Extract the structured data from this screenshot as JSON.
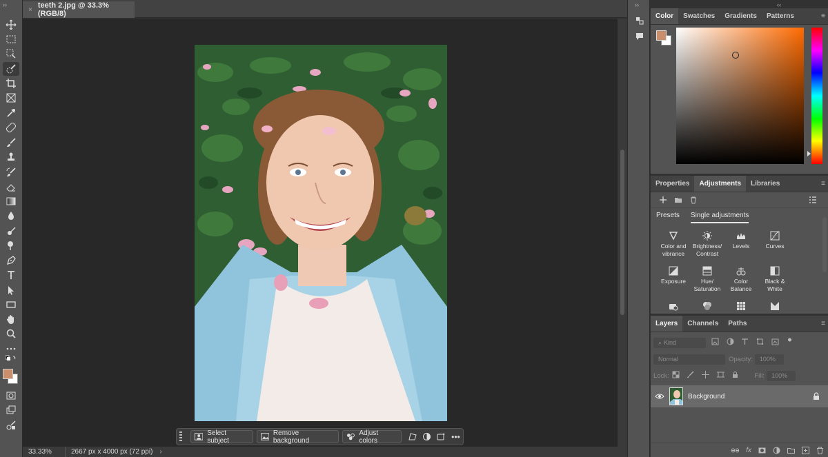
{
  "document": {
    "tab_title": "teeth 2.jpg @ 33.3% (RGB/8)",
    "close_glyph": "×"
  },
  "toolbar": {
    "tools": [
      "move-icon",
      "marquee-icon",
      "object-selection-icon",
      "quick-selection-icon",
      "crop-icon",
      "frame-icon",
      "eyedropper-icon",
      "healing-brush-icon",
      "brush-icon",
      "clone-stamp-icon",
      "history-brush-icon",
      "eraser-icon",
      "gradient-icon",
      "blur-icon",
      "dodge-icon",
      "burn-icon",
      "pen-icon",
      "type-icon",
      "path-selection-icon",
      "rectangle-icon",
      "hand-icon",
      "zoom-icon",
      "more-icon"
    ],
    "foreground_color": "#c98e6c",
    "background_color": "#ffffff"
  },
  "status": {
    "zoom": "33.33%",
    "dimensions": "2667 px x 4000 px (72 ppi)",
    "more": "›"
  },
  "taskbar": {
    "select_subject": "Select subject",
    "remove_background": "Remove background",
    "adjust_colors": "Adjust colors",
    "more": "•••"
  },
  "color_panel": {
    "tabs": [
      "Color",
      "Swatches",
      "Gradients",
      "Patterns"
    ],
    "active_tab": "Color",
    "hue_color": "#ff6a00",
    "menu_glyph": "≡"
  },
  "adjustments_panel": {
    "tabs": [
      "Properties",
      "Adjustments",
      "Libraries"
    ],
    "active_tab": "Adjustments",
    "subtabs": [
      "Presets",
      "Single adjustments"
    ],
    "active_subtab": "Single adjustments",
    "items": [
      {
        "label1": "Color and",
        "label2": "vibrance"
      },
      {
        "label1": "Brightness/",
        "label2": "Contrast"
      },
      {
        "label1": "Levels",
        "label2": ""
      },
      {
        "label1": "Curves",
        "label2": ""
      },
      {
        "label1": "Exposure",
        "label2": ""
      },
      {
        "label1": "Hue/",
        "label2": "Saturation"
      },
      {
        "label1": "Color",
        "label2": "Balance"
      },
      {
        "label1": "Black &",
        "label2": "White"
      }
    ],
    "menu_glyph": "≡"
  },
  "layers_panel": {
    "tabs": [
      "Layers",
      "Channels",
      "Paths"
    ],
    "active_tab": "Layers",
    "filter_placeholder": "Kind",
    "blend_mode": "Normal",
    "opacity_label": "Opacity:",
    "opacity_value": "100%",
    "lock_label": "Lock:",
    "fill_label": "Fill:",
    "fill_value": "100%",
    "layers": [
      {
        "name": "Background",
        "visible": true,
        "locked": true
      }
    ],
    "footer": {
      "fx": "fx"
    },
    "menu_glyph": "≡"
  },
  "misc": {
    "collapse_left": "››",
    "collapse_right": "‹‹"
  }
}
